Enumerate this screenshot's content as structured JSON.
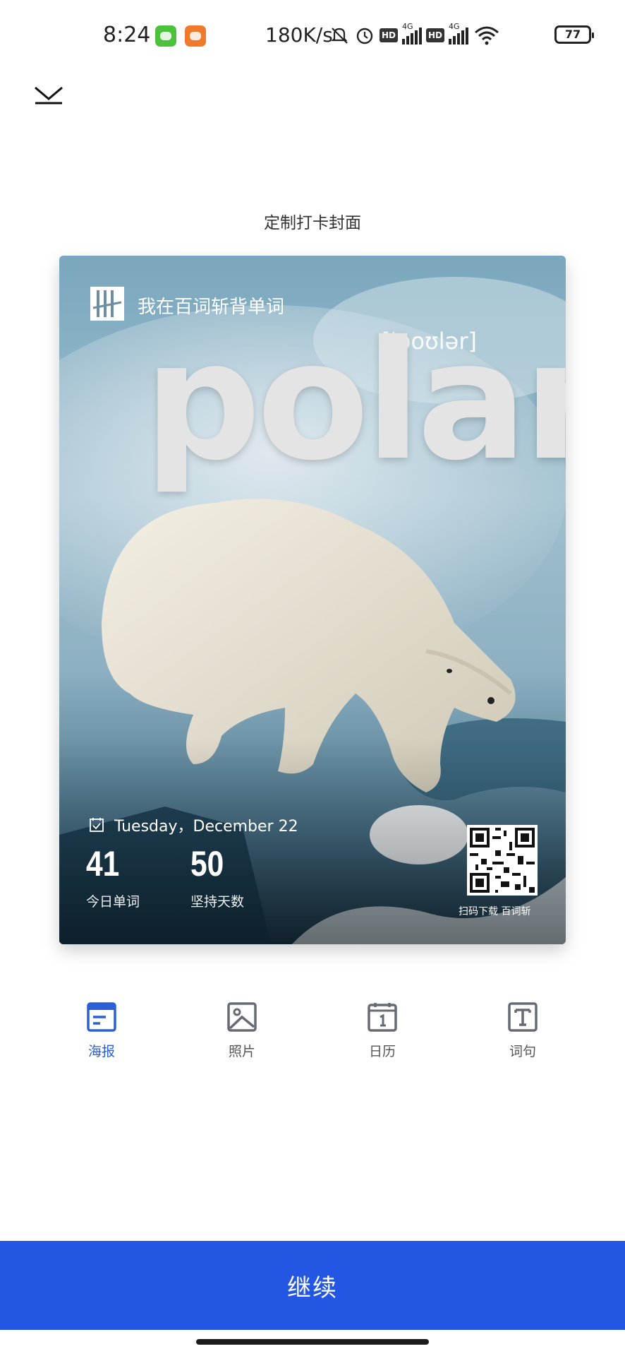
{
  "status_bar": {
    "time": "8:24",
    "net_speed": "180K/s",
    "hd_label": "HD",
    "net_type": "4G",
    "battery": "77",
    "icons": [
      "wechat-app-icon",
      "bird-app-icon",
      "mute-icon",
      "alarm-icon",
      "signal-icon",
      "wifi-icon",
      "battery-icon"
    ]
  },
  "header": {
    "title": "定制打卡封面"
  },
  "poster": {
    "brand_text": "我在百词斩背单词",
    "phonetic": "[ˈpoʊlər]",
    "word": "polar",
    "date": "Tuesday，December 22",
    "today_count": "41",
    "today_label": "今日单词",
    "days_count": "50",
    "days_label": "坚持天数",
    "qr_caption": "扫码下载 百词斩"
  },
  "tabs": [
    {
      "label": "海报",
      "icon": "poster-icon",
      "active": true
    },
    {
      "label": "照片",
      "icon": "photo-icon",
      "active": false
    },
    {
      "label": "日历",
      "icon": "calendar-icon",
      "active": false
    },
    {
      "label": "词句",
      "icon": "text-icon",
      "active": false
    }
  ],
  "footer": {
    "continue_label": "继续"
  },
  "colors": {
    "accent": "#2357e3",
    "tab_active": "#2a5fd6",
    "tab_inactive": "#666a75"
  }
}
